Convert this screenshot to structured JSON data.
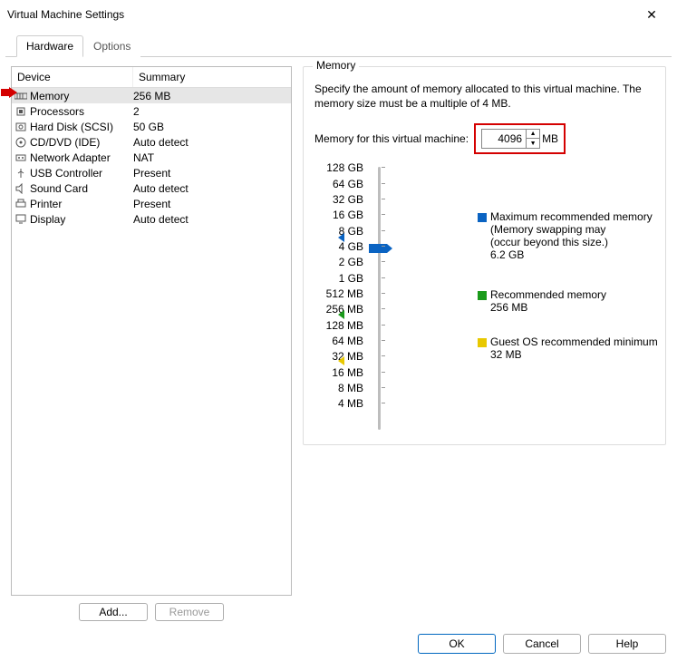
{
  "window": {
    "title": "Virtual Machine Settings"
  },
  "tabs": {
    "hardware": "Hardware",
    "options": "Options"
  },
  "device_table": {
    "headers": {
      "device": "Device",
      "summary": "Summary"
    },
    "rows": [
      {
        "name": "Memory",
        "summary": "256 MB",
        "icon": "memory-icon"
      },
      {
        "name": "Processors",
        "summary": "2",
        "icon": "cpu-icon"
      },
      {
        "name": "Hard Disk (SCSI)",
        "summary": "50 GB",
        "icon": "disk-icon"
      },
      {
        "name": "CD/DVD (IDE)",
        "summary": "Auto detect",
        "icon": "cd-icon"
      },
      {
        "name": "Network Adapter",
        "summary": "NAT",
        "icon": "network-icon"
      },
      {
        "name": "USB Controller",
        "summary": "Present",
        "icon": "usb-icon"
      },
      {
        "name": "Sound Card",
        "summary": "Auto detect",
        "icon": "sound-icon"
      },
      {
        "name": "Printer",
        "summary": "Present",
        "icon": "printer-icon"
      },
      {
        "name": "Display",
        "summary": "Auto detect",
        "icon": "display-icon"
      }
    ],
    "buttons": {
      "add": "Add...",
      "remove": "Remove"
    }
  },
  "memory": {
    "legend": "Memory",
    "specify": "Specify the amount of memory allocated to this virtual machine. The memory size must be a multiple of 4 MB.",
    "label": "Memory for this virtual machine:",
    "value": "4096",
    "unit": "MB",
    "scale": [
      "128 GB",
      "64 GB",
      "32 GB",
      "16 GB",
      "8 GB",
      "4 GB",
      "2 GB",
      "1 GB",
      "512 MB",
      "256 MB",
      "128 MB",
      "64 MB",
      "32 MB",
      "16 MB",
      "8 MB",
      "4 MB"
    ],
    "legend_items": {
      "max": {
        "title": "Maximum recommended memory",
        "note": "(Memory swapping may occur beyond this size.)",
        "value": "6.2 GB",
        "color": "#0a63c2"
      },
      "rec": {
        "title": "Recommended memory",
        "value": "256 MB",
        "color": "#1a9a1a"
      },
      "min": {
        "title": "Guest OS recommended minimum",
        "value": "32 MB",
        "color": "#e8c800"
      }
    }
  },
  "footer": {
    "ok": "OK",
    "cancel": "Cancel",
    "help": "Help"
  }
}
